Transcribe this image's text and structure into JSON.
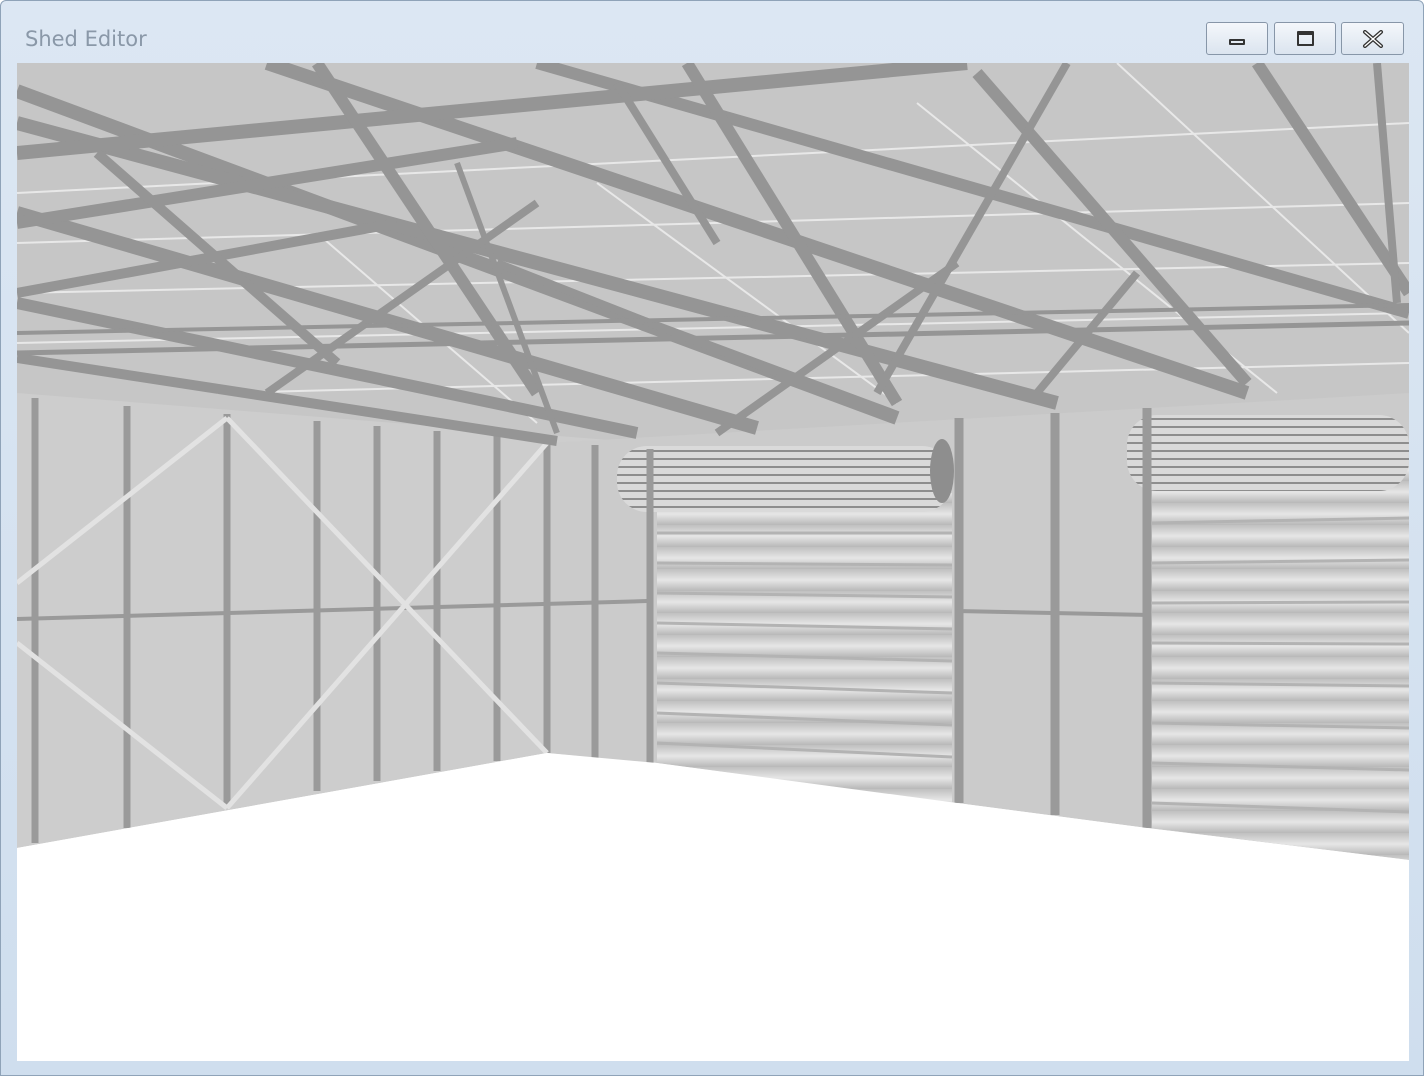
{
  "window": {
    "title": "Shed Editor"
  },
  "controls": {
    "minimize_icon": "minimize-icon",
    "maximize_icon": "maximize-icon",
    "close_icon": "close-icon"
  },
  "scene": {
    "description_icon": "shed-3d-viewport",
    "colors": {
      "steel": "#959595",
      "cladding": "#cdcdcd",
      "roof": "#c4c4c4",
      "floor": "#ffffff",
      "bracing": "#e0e0e0"
    }
  }
}
